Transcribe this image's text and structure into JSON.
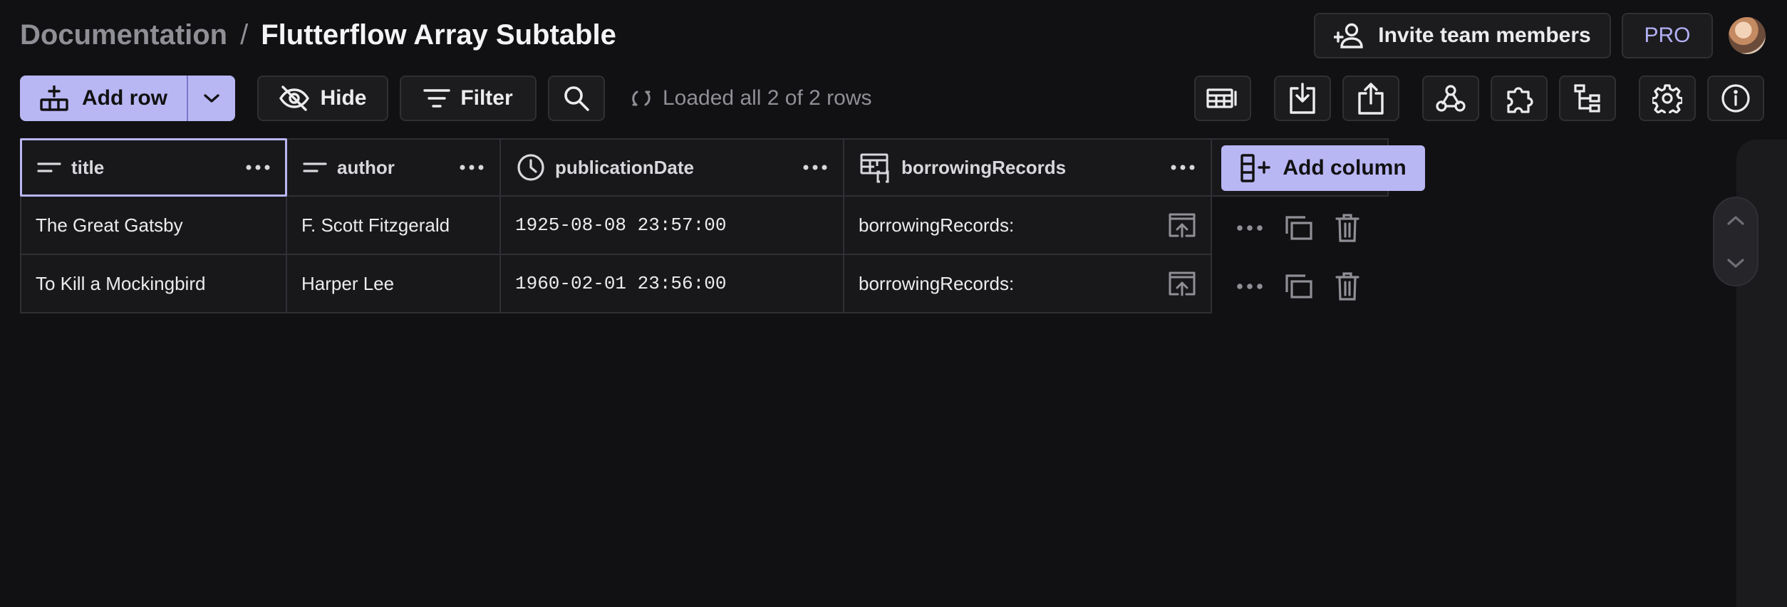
{
  "breadcrumb": {
    "parent": "Documentation",
    "separator": "/",
    "current": "Flutterflow Array Subtable"
  },
  "header": {
    "invite_label": "Invite team members",
    "plan_badge": "PRO"
  },
  "toolbar": {
    "add_row_label": "Add row",
    "hide_label": "Hide",
    "filter_label": "Filter",
    "status_text": "Loaded all 2 of 2 rows",
    "icons": [
      "table-view-icon",
      "import-icon",
      "export-icon",
      "webhook-icon",
      "extensions-icon",
      "hierarchy-icon",
      "settings-icon",
      "info-icon"
    ]
  },
  "table": {
    "columns": [
      {
        "name": "title",
        "icon": "text-icon"
      },
      {
        "name": "author",
        "icon": "text-icon"
      },
      {
        "name": "publicationDate",
        "icon": "clock-icon"
      },
      {
        "name": "borrowingRecords",
        "icon": "subtable-icon"
      }
    ],
    "add_column_label": "Add column",
    "rows": [
      {
        "title": "The Great Gatsby",
        "author": "F. Scott Fitzgerald",
        "publicationDate": "1925-08-08 23:57:00",
        "borrowingRecords": "borrowingRecords:"
      },
      {
        "title": "To Kill a Mockingbird",
        "author": "Harper Lee",
        "publicationDate": "1960-02-01 23:56:00",
        "borrowingRecords": "borrowingRecords:"
      }
    ]
  },
  "colors": {
    "accent": "#b9b6f4",
    "background": "#111113",
    "surface": "#18181b",
    "border": "#2f2f34"
  }
}
